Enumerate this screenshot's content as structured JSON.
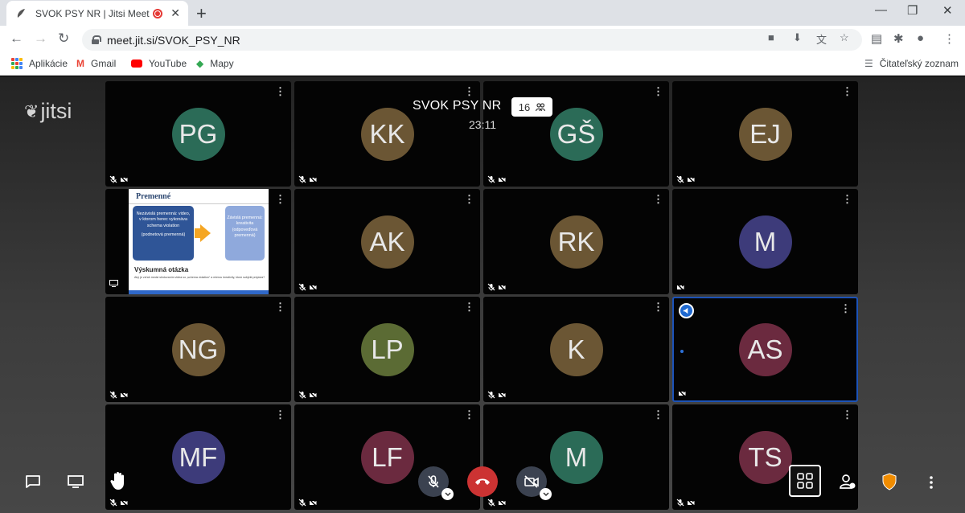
{
  "browser": {
    "tab_title": "SVOK PSY NR | Jitsi Meet",
    "url": "meet.jit.si/SVOK_PSY_NR",
    "bookmarks": [
      {
        "label": "Aplikácie"
      },
      {
        "label": "Gmail"
      },
      {
        "label": "YouTube"
      },
      {
        "label": "Mapy"
      }
    ],
    "reading_list": "Čitateľský zoznam"
  },
  "meeting": {
    "logo": "jitsi",
    "title": "SVOK PSY NR",
    "timer": "23:11",
    "participant_count": "16"
  },
  "participants": [
    {
      "initials": "PG",
      "color": "#2b6b57"
    },
    {
      "initials": "KK",
      "color": "#6b5634"
    },
    {
      "initials": "GŠ",
      "color": "#2b6b57"
    },
    {
      "initials": "EJ",
      "color": "#6b5634"
    },
    {
      "initials": "AK",
      "color": "#6b5634"
    },
    {
      "initials": "RK",
      "color": "#6b5634"
    },
    {
      "initials": "M",
      "color": "#3d3b7a"
    },
    {
      "initials": "NG",
      "color": "#6b5634"
    },
    {
      "initials": "LP",
      "color": "#5b6b34"
    },
    {
      "initials": "K",
      "color": "#6b5634"
    },
    {
      "initials": "AS",
      "color": "#6b2a3f"
    },
    {
      "initials": "MF",
      "color": "#3d3b7a"
    },
    {
      "initials": "LF",
      "color": "#6b2a3f"
    },
    {
      "initials": "M",
      "color": "#2b6b57"
    },
    {
      "initials": "TS",
      "color": "#6b2a3f"
    }
  ],
  "slide": {
    "heading": "Premenné",
    "independent": "Nezávislá premenná: video, v ktorom herec vykonáva schema violation",
    "independent_note": "(podnetová premenná)",
    "dependent": "Závislá premenná: kreativita",
    "dependent_note": "(odpoveďová premenná)",
    "question": "Výskumná otázka",
    "question_text": "Aký je vzťah medzi sledovaním videa so „schema violation“ a mierou kreativity, ktorú subjekt prejavia?"
  }
}
